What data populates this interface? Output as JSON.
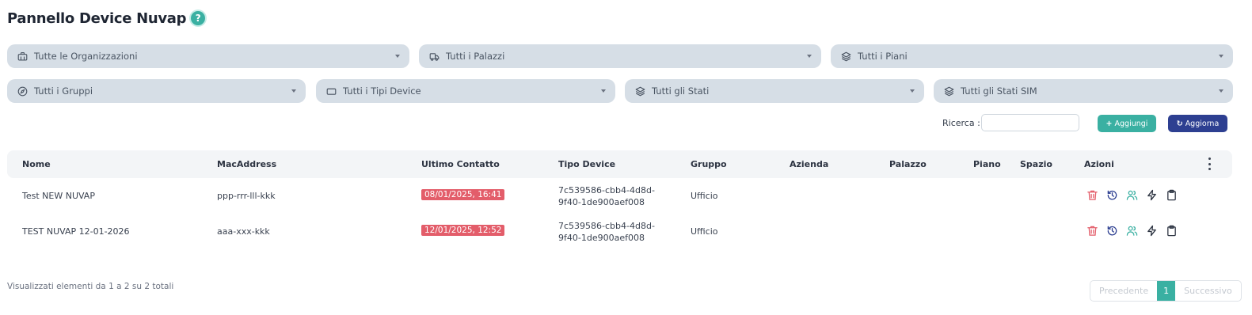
{
  "page": {
    "title": "Pannello Device Nuvap",
    "help_icon": "?"
  },
  "filters": {
    "row1": [
      {
        "label": "Tutte le Organizzazioni",
        "icon": "briefcase-icon"
      },
      {
        "label": "Tutti i Palazzi",
        "icon": "truck-icon"
      },
      {
        "label": "Tutti i Piani",
        "icon": "layers-icon"
      }
    ],
    "row2": [
      {
        "label": "Tutti i Gruppi",
        "icon": "compass-icon"
      },
      {
        "label": "Tutti i Tipi Device",
        "icon": "tablet-icon"
      },
      {
        "label": "Tutti gli Stati",
        "icon": "layers-icon"
      },
      {
        "label": "Tutti gli Stati SIM",
        "icon": "layers-icon"
      }
    ]
  },
  "toolbar": {
    "search_label": "Ricerca :",
    "search_value": "",
    "add_label": "Aggiungi",
    "add_icon": "+",
    "refresh_label": "Aggiorna",
    "refresh_icon": "↻"
  },
  "table": {
    "columns": [
      "Nome",
      "MacAddress",
      "Ultimo Contatto",
      "Tipo Device",
      "Gruppo",
      "Azienda",
      "Palazzo",
      "Piano",
      "Spazio",
      "Azioni"
    ],
    "rows": [
      {
        "nome": "Test NEW NUVAP",
        "mac": "ppp-rrr-lll-kkk",
        "ultimo_contatto": "08/01/2025, 16:41",
        "tipo_line1": "7c539586-cbb4-4d8d-",
        "tipo_line2": "9f40-1de900aef008",
        "gruppo": "Ufficio",
        "azienda": "",
        "palazzo": "",
        "piano": "",
        "spazio": ""
      },
      {
        "nome": "TEST NUVAP 12-01-2026",
        "mac": "aaa-xxx-kkk",
        "ultimo_contatto": "12/01/2025, 12:52",
        "tipo_line1": "7c539586-cbb4-4d8d-",
        "tipo_line2": "9f40-1de900aef008",
        "gruppo": "Ufficio",
        "azienda": "",
        "palazzo": "",
        "piano": "",
        "spazio": ""
      }
    ],
    "action_icons": [
      "trash-icon",
      "history-icon",
      "users-icon",
      "bolt-icon",
      "clipboard-icon"
    ]
  },
  "footer": {
    "info": "Visualizzati elementi da 1 a 2 su 2 totali",
    "prev": "Precedente",
    "page": "1",
    "next": "Successivo"
  },
  "colors": {
    "accent": "#3ab0a2",
    "primary": "#2d3f91",
    "danger": "#e35d6a",
    "filter_bg": "#d6dee6"
  }
}
